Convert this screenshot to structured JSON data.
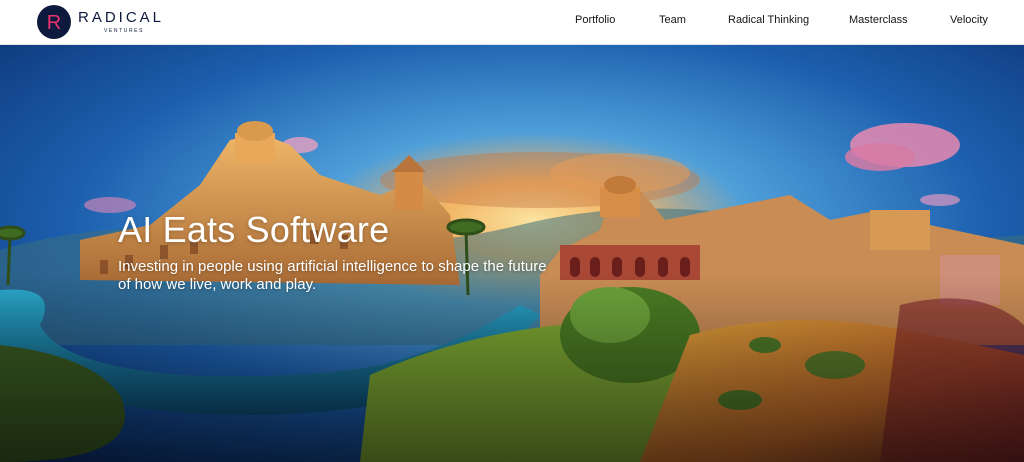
{
  "brand": {
    "name": "RADICAL",
    "subname": "VENTURES",
    "logo_letter": "R",
    "logo_bg": "#0e1a3d",
    "logo_accent": "#e8336e"
  },
  "nav": {
    "items": [
      {
        "label": "Portfolio"
      },
      {
        "label": "Team"
      },
      {
        "label": "Radical Thinking"
      },
      {
        "label": "Masterclass"
      },
      {
        "label": "Velocity"
      }
    ]
  },
  "hero": {
    "title": "AI Eats Software",
    "subtitle": "Investing in people using artificial intelligence to shape the future of how we live, work and play."
  },
  "colors": {
    "sky_top": "#0f3f86",
    "sky_glow": "#f6c86a",
    "water": "#1f8fb8",
    "grass": "#6d9a2c",
    "ground": "#c98a2a"
  }
}
